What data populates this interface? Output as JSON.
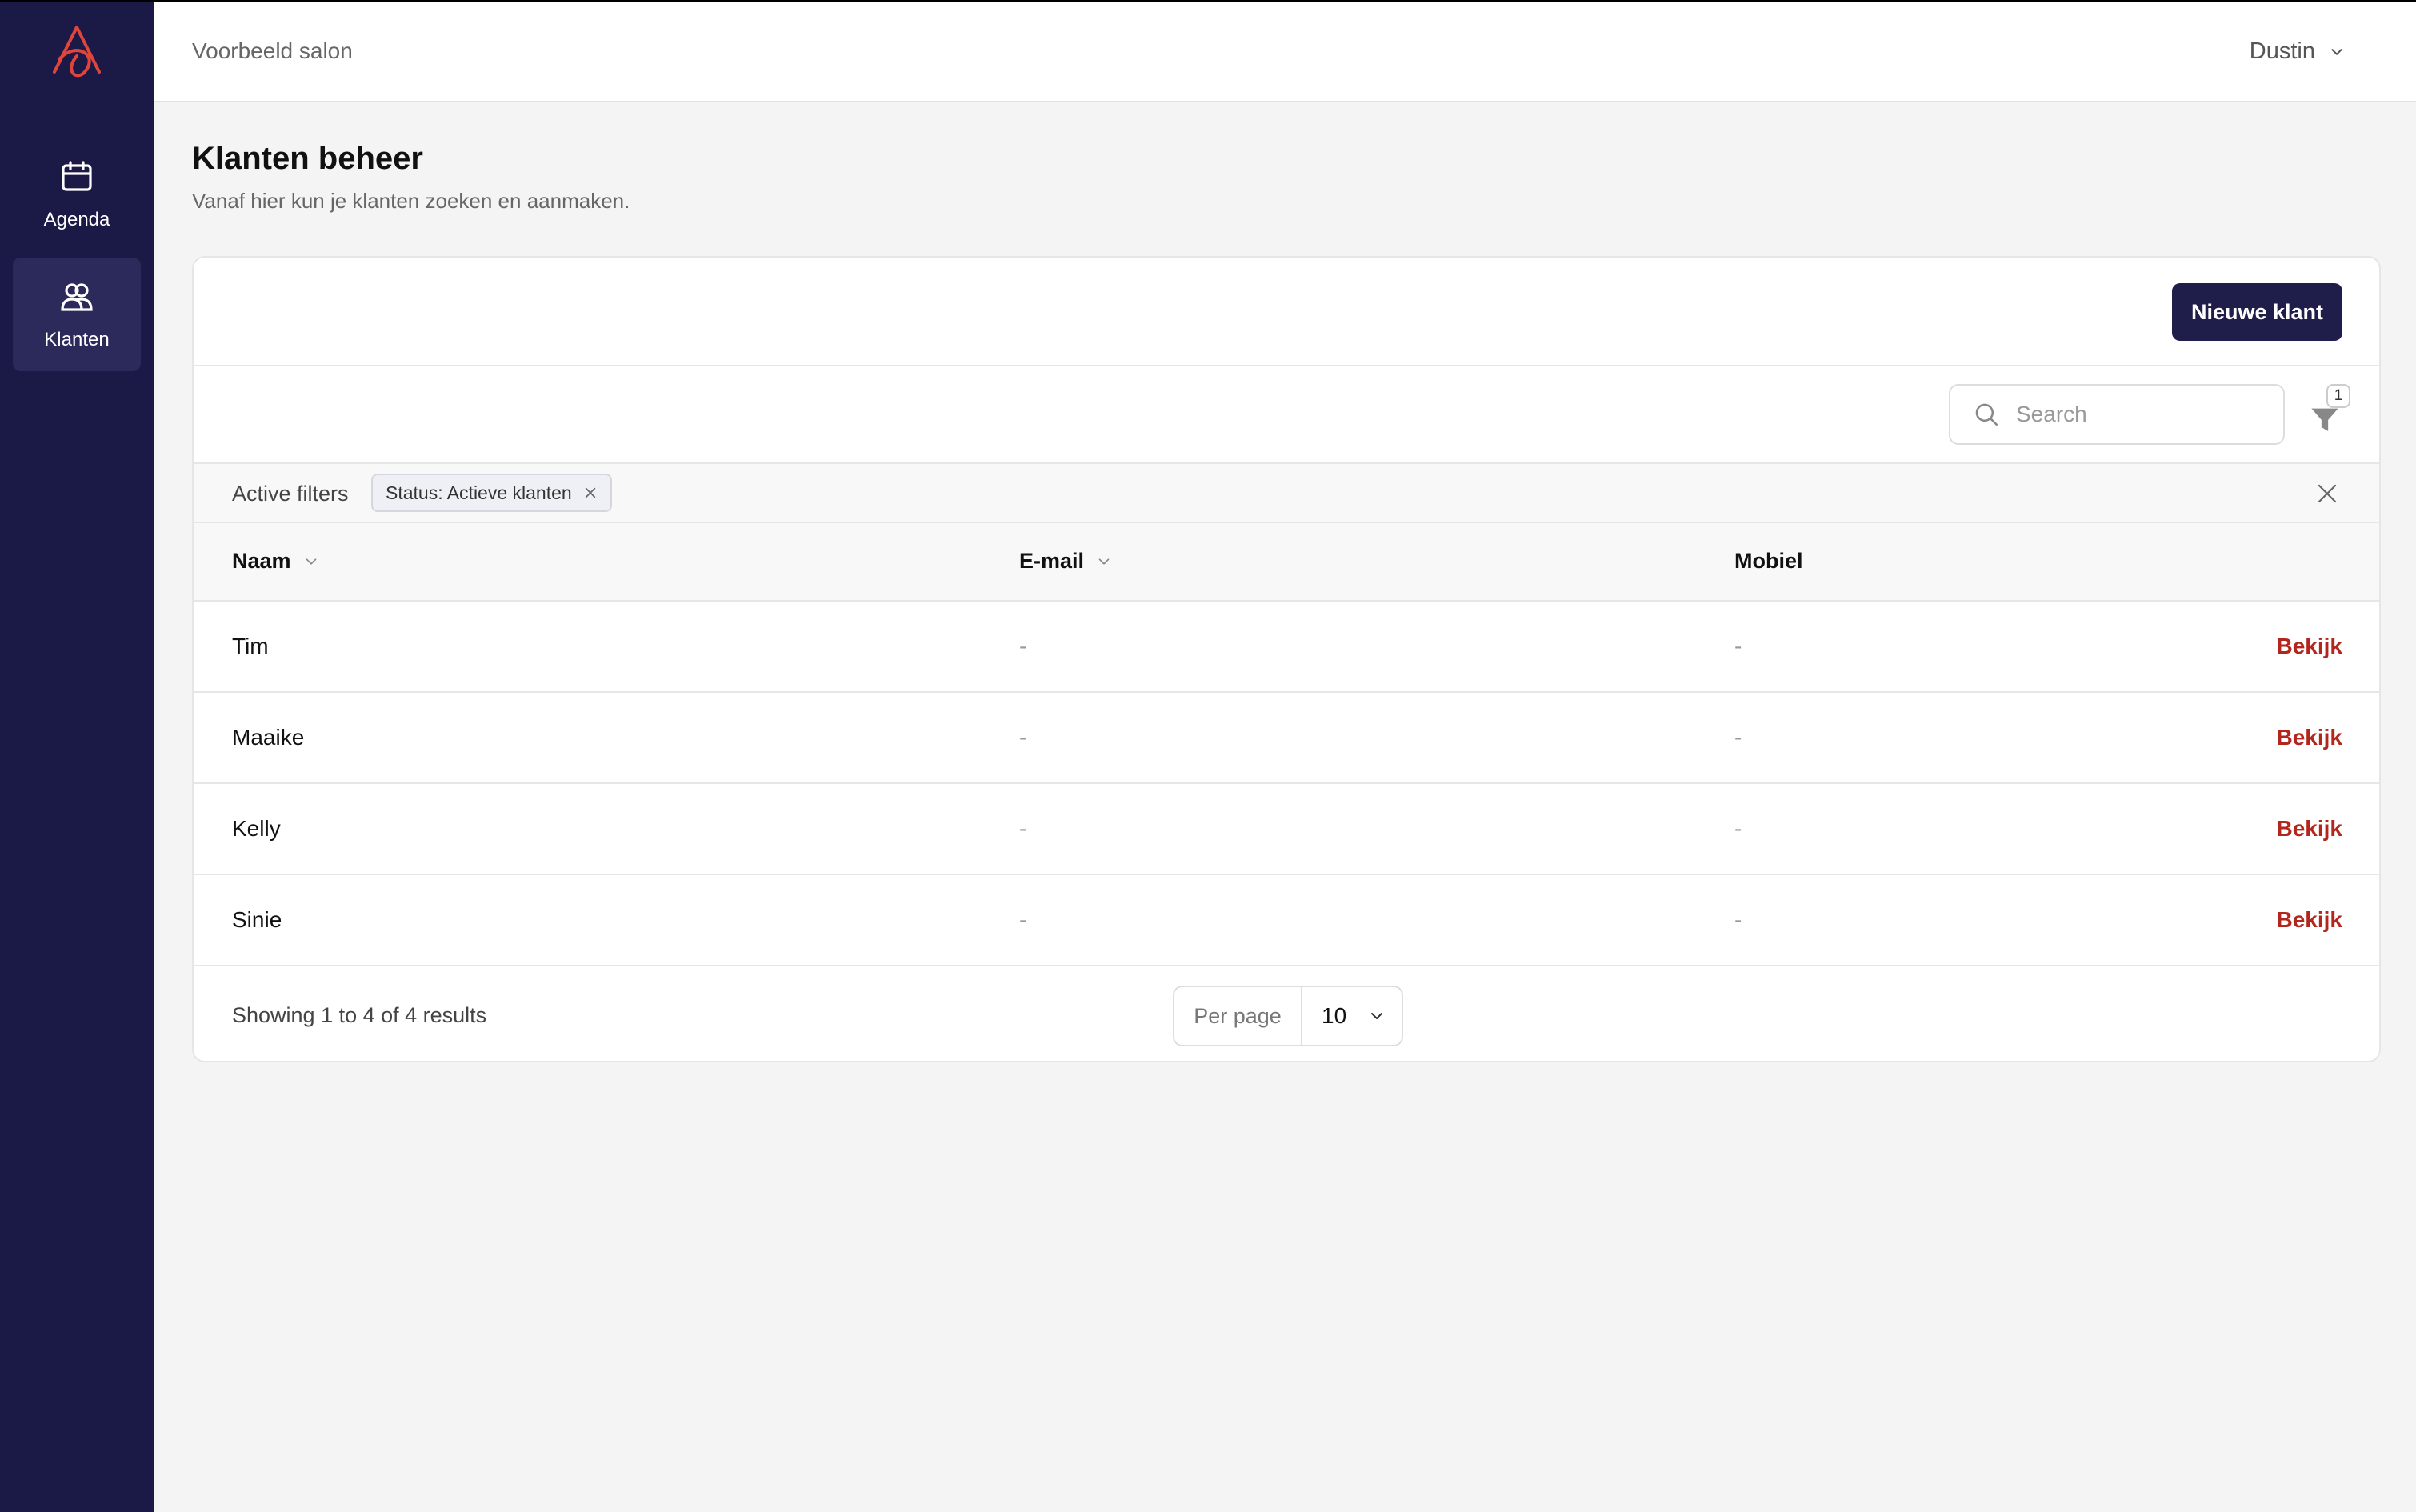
{
  "sidebar": {
    "items": [
      {
        "label": "Agenda",
        "icon": "calendar-icon"
      },
      {
        "label": "Klanten",
        "icon": "users-icon",
        "active": true
      }
    ]
  },
  "topbar": {
    "salon_name": "Voorbeeld salon",
    "user_name": "Dustin"
  },
  "header": {
    "title": "Klanten beheer",
    "subtitle": "Vanaf hier kun je klanten zoeken en aanmaken."
  },
  "toolbar": {
    "new_button": "Nieuwe klant"
  },
  "search": {
    "placeholder": "Search",
    "value": "",
    "filter_count": "1"
  },
  "filters": {
    "label": "Active filters",
    "chips": [
      "Status: Actieve klanten"
    ]
  },
  "table": {
    "columns": [
      "Naam",
      "E-mail",
      "Mobiel"
    ],
    "action_label": "Bekijk",
    "rows": [
      {
        "naam": "Tim",
        "email": "-",
        "mobiel": "-"
      },
      {
        "naam": "Maaike",
        "email": "-",
        "mobiel": "-"
      },
      {
        "naam": "Kelly",
        "email": "-",
        "mobiel": "-"
      },
      {
        "naam": "Sinie",
        "email": "-",
        "mobiel": "-"
      }
    ]
  },
  "pagination": {
    "summary": "Showing 1 to 4 of 4 results",
    "per_page_label": "Per page",
    "per_page_value": "10"
  },
  "colors": {
    "sidebar": "#1b1a47",
    "primary_button": "#1f1d4a",
    "action_link": "#b3261e",
    "logo": "#e0443a"
  }
}
